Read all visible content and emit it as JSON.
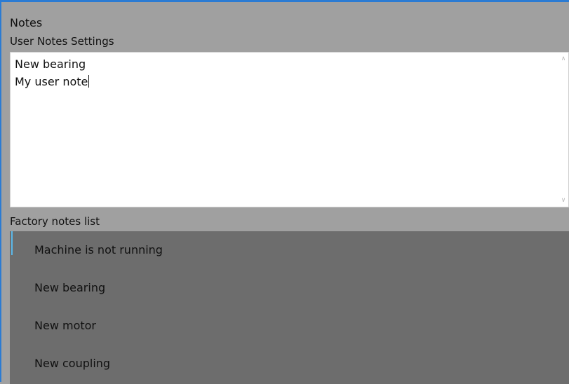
{
  "window": {
    "title": "Notes"
  },
  "user_notes": {
    "label": "User Notes Settings",
    "lines": [
      "New bearing",
      "My user note"
    ]
  },
  "factory_notes": {
    "label": "Factory notes list",
    "items": [
      {
        "label": "Machine is not running",
        "selected": true
      },
      {
        "label": "New bearing",
        "selected": false
      },
      {
        "label": "New motor",
        "selected": false
      },
      {
        "label": "New coupling",
        "selected": false
      }
    ]
  },
  "colors": {
    "window_border": "#2b7bd3",
    "background": "#a0a0a0",
    "list_background": "#6d6d6d",
    "selection_indicator": "#5bb7e8"
  },
  "icons": {
    "scroll_up": "chevron-up-icon",
    "scroll_down": "chevron-down-icon"
  }
}
